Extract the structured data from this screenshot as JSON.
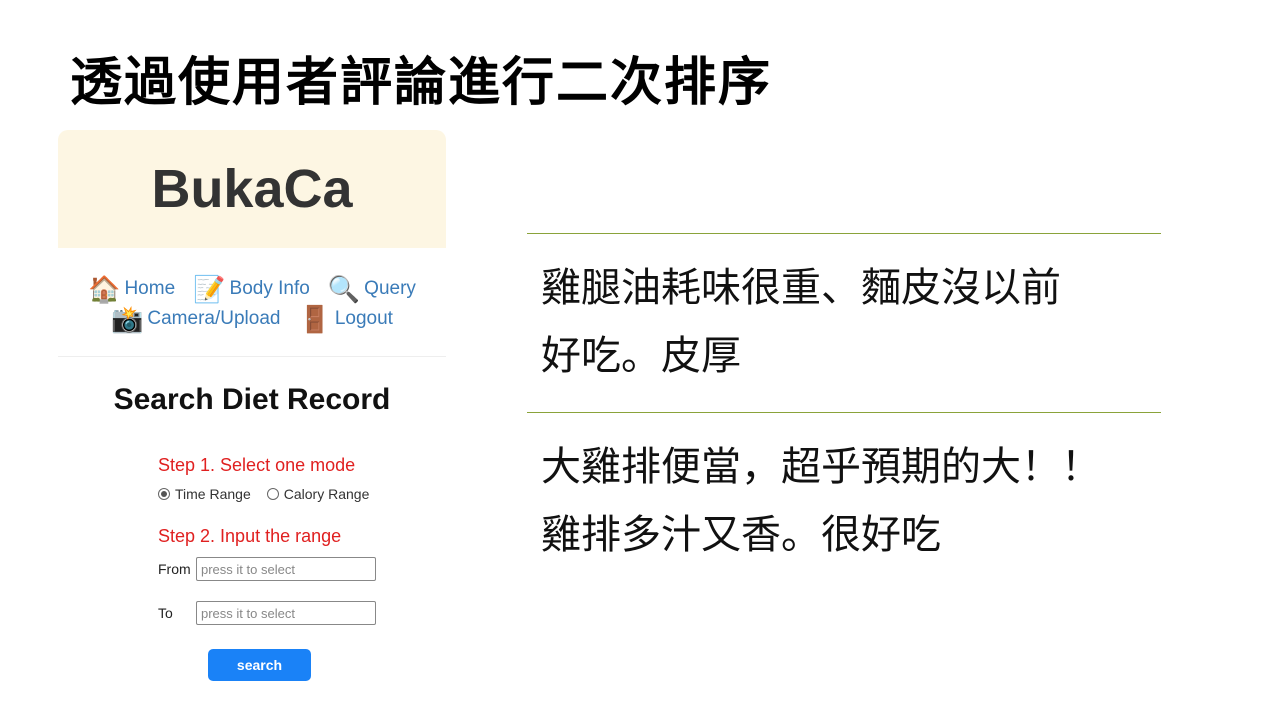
{
  "slide": {
    "title": "透過使用者評論進行二次排序"
  },
  "app": {
    "name": "BukaCa",
    "nav": {
      "row1": [
        {
          "icon": "🏠",
          "label": "Home"
        },
        {
          "icon": "📝",
          "label": "Body Info"
        },
        {
          "icon": "🔍",
          "label": "Query"
        }
      ],
      "row2": [
        {
          "icon": "📸",
          "label": "Camera/Upload"
        },
        {
          "icon": "🚪",
          "label": "Logout"
        }
      ]
    },
    "form": {
      "title": "Search Diet Record",
      "step1": "Step 1. Select one mode",
      "mode_time": "Time Range",
      "mode_calory": "Calory Range",
      "selected_mode": "Time Range",
      "step2": "Step 2. Input the range",
      "from_label": "From",
      "from_placeholder": "press it to select",
      "to_label": "To",
      "to_placeholder": "press it to select",
      "search_label": "search"
    }
  },
  "reviews": [
    {
      "line1": "雞腿油耗味很重、麵皮沒以前",
      "line2": "好吃。皮厚"
    },
    {
      "line1": "大雞排便當，超乎預期的大！！",
      "line2": "雞排多汁又香。很好吃"
    }
  ],
  "colors": {
    "header_bg": "#fdf6e3",
    "link": "#3a7bb8",
    "step": "#e02020",
    "button": "#1a82f7",
    "divider": "#8aa33a"
  }
}
